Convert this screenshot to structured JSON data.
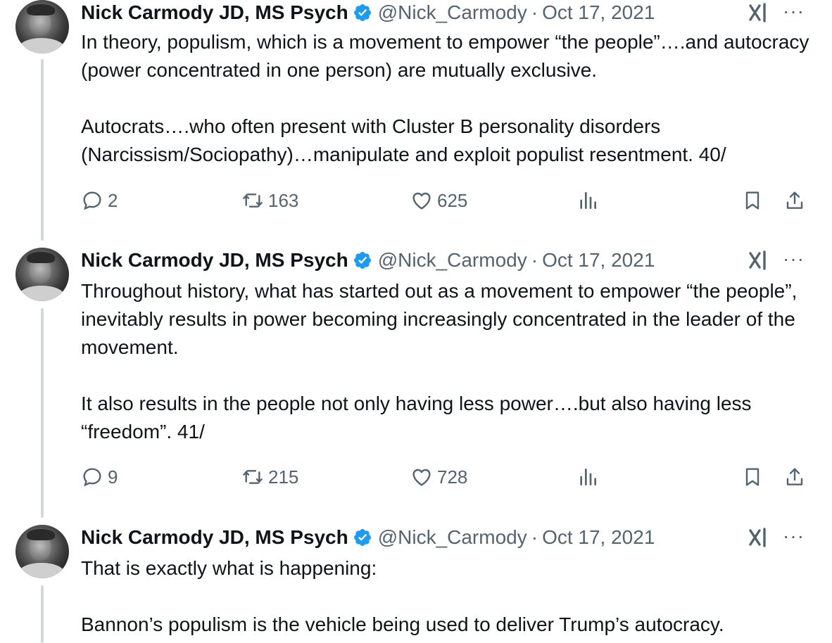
{
  "author": {
    "name": "Nick Carmody JD, MS Psych",
    "handle": "@Nick_Carmody",
    "separator": "·",
    "more_label": "···"
  },
  "colors": {
    "verified_blue": "#1d9bf0",
    "secondary_text": "#536471",
    "thread_line": "#cfd9de"
  },
  "icons": {
    "reply": "reply-icon",
    "repost": "repost-icon",
    "like": "like-icon",
    "views": "views-icon",
    "bookmark": "bookmark-icon",
    "share": "share-icon",
    "grok": "grok-icon",
    "verified": "verified-badge-icon"
  },
  "tweets": [
    {
      "date": "Oct 17, 2021",
      "paragraphs": [
        "In theory, populism, which is a movement to empower “the people”….and autocracy (power concentrated in one person) are mutually exclusive.",
        "Autocrats….who often present with Cluster B personality disorders (Narcissism/Sociopathy)…manipulate and exploit populist resentment. 40/"
      ],
      "replies": "2",
      "reposts": "163",
      "likes": "625"
    },
    {
      "date": "Oct 17, 2021",
      "paragraphs": [
        "Throughout history, what has started out as a movement to empower “the people”, inevitably results in power becoming increasingly concentrated in the leader of the movement.",
        "It also results in the people not only having less power….but also having less “freedom”.  41/"
      ],
      "replies": "9",
      "reposts": "215",
      "likes": "728"
    },
    {
      "date": "Oct 17, 2021",
      "paragraphs": [
        "That is exactly what is happening:",
        "Bannon’s populism is the vehicle being used to deliver Trump’s autocracy."
      ]
    }
  ]
}
